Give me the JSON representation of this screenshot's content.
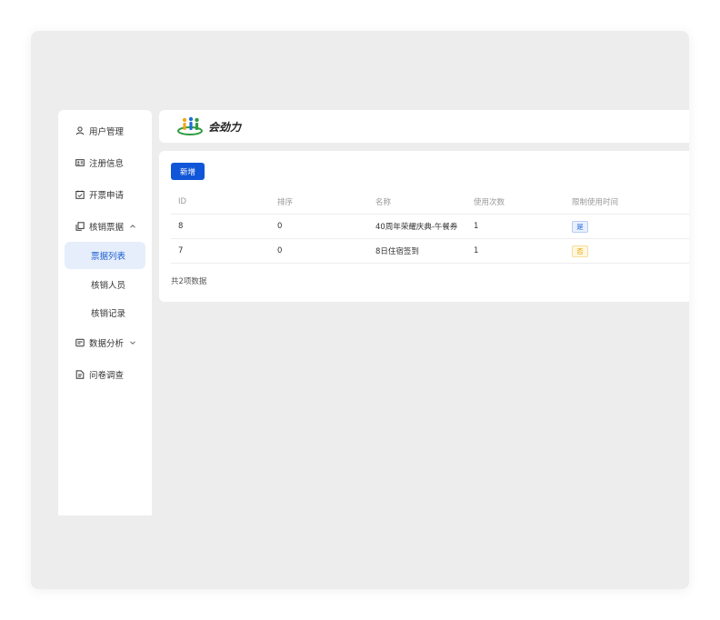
{
  "logo": {
    "text": "会劲力"
  },
  "sidebar": {
    "items": [
      {
        "label": "用户管理",
        "icon": "user-icon"
      },
      {
        "label": "注册信息",
        "icon": "id-card-icon"
      },
      {
        "label": "开票申请",
        "icon": "invoice-icon"
      },
      {
        "label": "核销票据",
        "icon": "copy-icon",
        "expanded": true,
        "children": [
          "票据列表",
          "核销人员",
          "核销记录"
        ]
      },
      {
        "label": "数据分析",
        "icon": "analytics-icon",
        "expanded": false
      },
      {
        "label": "问卷调查",
        "icon": "survey-icon"
      }
    ],
    "active": "票据列表"
  },
  "toolbar": {
    "add_label": "新增"
  },
  "table": {
    "columns": [
      "ID",
      "排序",
      "名称",
      "使用次数",
      "限制使用时间"
    ],
    "rows": [
      {
        "id": "8",
        "sort": "0",
        "name": "40周年荣耀庆典-午餐券",
        "uses": "1",
        "limit": "是"
      },
      {
        "id": "7",
        "sort": "0",
        "name": "8日住宿签到",
        "uses": "1",
        "limit": "否"
      }
    ]
  },
  "footer": {
    "total": "共2项数据"
  },
  "colors": {
    "primary": "#1156d8",
    "active_bg": "#e6eefb",
    "tag_yes": "#1d5fd1",
    "tag_no": "#e0a400"
  }
}
